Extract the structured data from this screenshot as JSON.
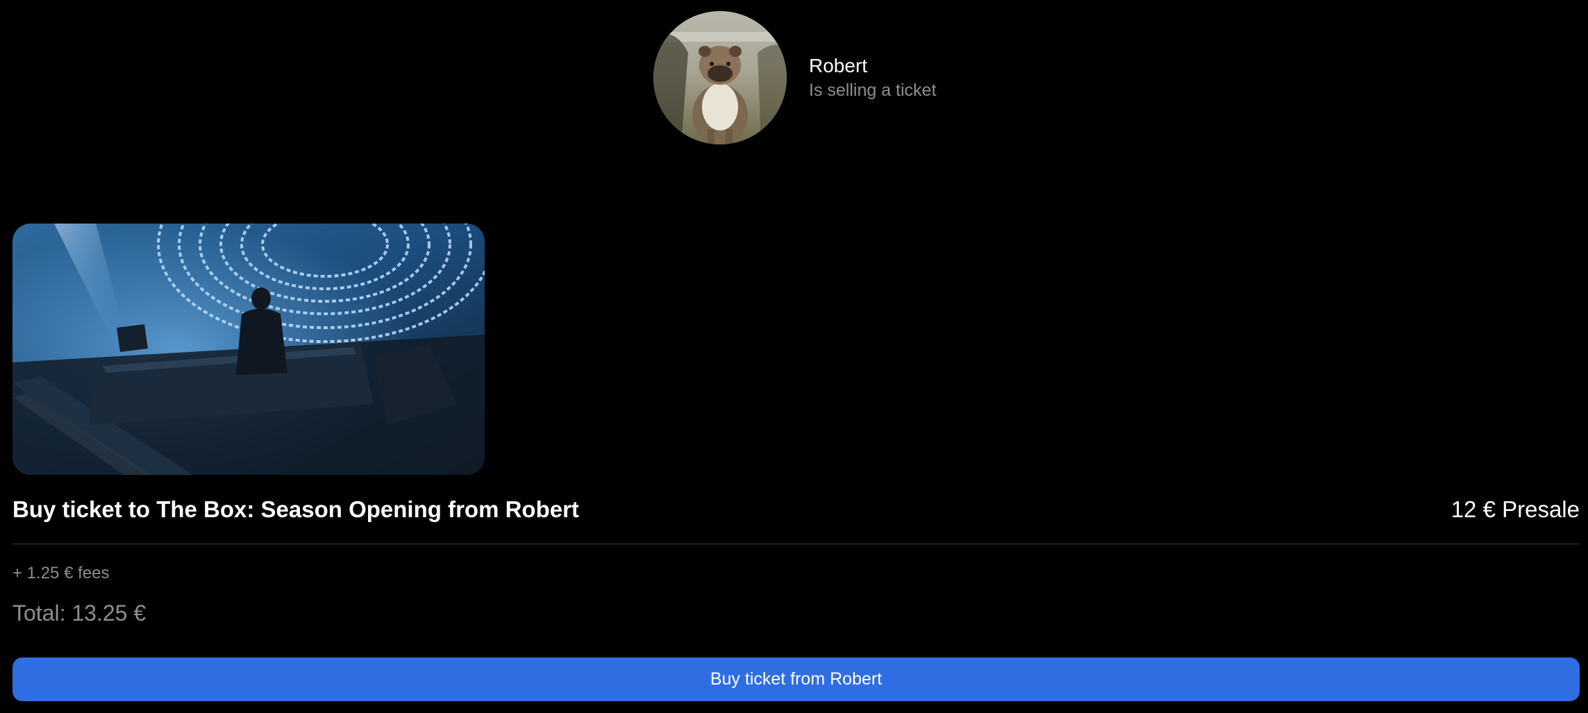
{
  "seller": {
    "name": "Robert",
    "subtitle": "Is selling a ticket"
  },
  "ticket": {
    "title": "Buy ticket to The Box: Season Opening from Robert",
    "price": "12 € Presale",
    "fees": "+ 1.25 € fees",
    "total": "Total: 13.25 €"
  },
  "actions": {
    "buy_label": "Buy ticket from Robert"
  },
  "colors": {
    "background": "#000000",
    "accent": "#2f6de3",
    "secondary_text": "#8e8e93",
    "divider": "#3a3a3c"
  }
}
